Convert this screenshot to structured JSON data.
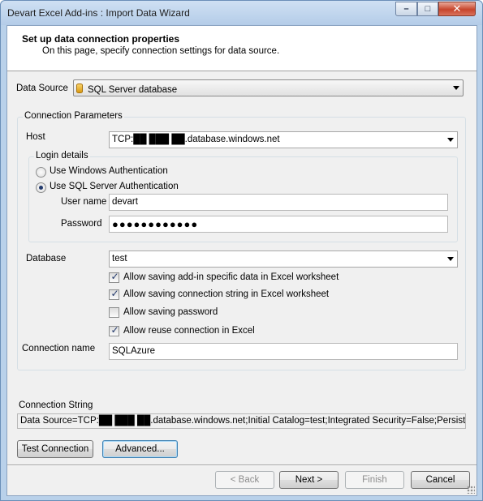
{
  "window": {
    "title": "Devart Excel Add-ins : Import Data Wizard"
  },
  "header": {
    "title": "Set up data connection properties",
    "subtitle": "On this page, specify connection settings for data source."
  },
  "data_source": {
    "label": "Data Source",
    "value": "SQL Server database",
    "icon": "database-icon"
  },
  "connection_parameters": {
    "legend": "Connection Parameters",
    "host_label": "Host",
    "host_value": "TCP:██ ███ ██.database.windows.net",
    "login": {
      "legend": "Login details",
      "windows_auth_label": "Use Windows Authentication",
      "windows_auth_selected": false,
      "sql_auth_label": "Use SQL Server Authentication",
      "sql_auth_selected": true,
      "username_label": "User name",
      "username_value": "devart",
      "password_label": "Password",
      "password_value": "●●●●●●●●●●●●"
    },
    "database_label": "Database",
    "database_value": "test",
    "options": [
      {
        "label": "Allow saving add-in specific data in Excel worksheet",
        "checked": true
      },
      {
        "label": "Allow saving connection string in Excel worksheet",
        "checked": true
      },
      {
        "label": "Allow saving password",
        "checked": false
      },
      {
        "label": "Allow reuse connection in Excel",
        "checked": true
      }
    ],
    "connection_name_label": "Connection name",
    "connection_name_value": "SQLAzure"
  },
  "connection_string": {
    "label": "Connection String",
    "value": "Data Source=TCP:██ ███ ██.database.windows.net;Initial Catalog=test;Integrated Security=False;Persist Security I"
  },
  "buttons": {
    "test_connection": "Test Connection",
    "advanced": "Advanced...",
    "back": "< Back",
    "next": "Next >",
    "finish": "Finish",
    "cancel": "Cancel"
  },
  "window_controls": {
    "minimize": "–",
    "maximize": "□",
    "close": "✕"
  }
}
